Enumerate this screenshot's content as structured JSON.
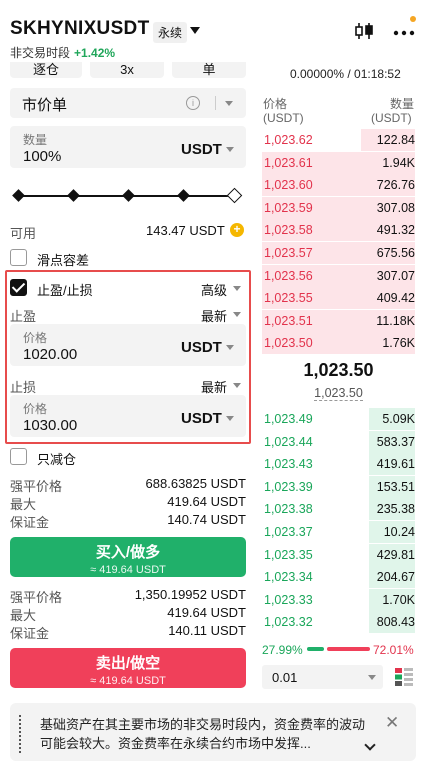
{
  "header": {
    "symbol": "SKHYNIXUSDT",
    "contract_type": "永续",
    "session": "非交易时段",
    "change_pct": "+1.42%"
  },
  "funding": {
    "text": "0.00000% / 01:18:52"
  },
  "margin_mode": {
    "isolated_label": "逐仓",
    "leverage_label": "3x",
    "mode_label": "单"
  },
  "order_form": {
    "order_type": "市价单",
    "qty_label": "数量",
    "qty_value": "100%",
    "qty_unit": "USDT",
    "slider_percent": 100,
    "available_label": "可用",
    "available_value": "143.47 USDT",
    "slippage_label": "滑点容差",
    "tpsl_label": "止盈/止损",
    "tpsl_mode": "高级",
    "take_profit": {
      "label": "止盈",
      "mode": "最新",
      "price_label": "价格",
      "price_value": "1020.00",
      "unit": "USDT"
    },
    "stop_loss": {
      "label": "止损",
      "mode": "最新",
      "price_label": "价格",
      "price_value": "1030.00",
      "unit": "USDT"
    },
    "reduce_only_label": "只减仓"
  },
  "buy_info": {
    "liq_label": "强平价格",
    "liq_value": "688.63825 USDT",
    "max_label": "最大",
    "max_value": "419.64 USDT",
    "margin_label": "保证金",
    "margin_value": "140.74 USDT",
    "button": "买入/做多",
    "button_sub": "≈ 419.64 USDT"
  },
  "sell_info": {
    "liq_label": "强平价格",
    "liq_value": "1,350.19952 USDT",
    "max_label": "最大",
    "max_value": "419.64 USDT",
    "margin_label": "保证金",
    "margin_value": "140.11 USDT",
    "button": "卖出/做空",
    "button_sub": "≈ 419.64 USDT"
  },
  "orderbook": {
    "price_header": "价格",
    "price_unit": "(USDT)",
    "qty_header": "数量",
    "qty_unit": "(USDT)",
    "asks": [
      {
        "price": "1,023.62",
        "qty": "122.84",
        "depth": 0.35
      },
      {
        "price": "1,023.61",
        "qty": "1.94K",
        "depth": 1.0
      },
      {
        "price": "1,023.60",
        "qty": "726.76",
        "depth": 1.0
      },
      {
        "price": "1,023.59",
        "qty": "307.08",
        "depth": 1.0
      },
      {
        "price": "1,023.58",
        "qty": "491.32",
        "depth": 1.0
      },
      {
        "price": "1,023.57",
        "qty": "675.56",
        "depth": 1.0
      },
      {
        "price": "1,023.56",
        "qty": "307.07",
        "depth": 1.0
      },
      {
        "price": "1,023.55",
        "qty": "409.42",
        "depth": 1.0
      },
      {
        "price": "1,023.51",
        "qty": "11.18K",
        "depth": 1.0
      },
      {
        "price": "1,023.50",
        "qty": "1.76K",
        "depth": 1.0
      }
    ],
    "mid_price": "1,023.50",
    "mark_price": "1,023.50",
    "bids": [
      {
        "price": "1,023.49",
        "qty": "5.09K",
        "depth": 0.3
      },
      {
        "price": "1,023.44",
        "qty": "583.37",
        "depth": 0.3
      },
      {
        "price": "1,023.43",
        "qty": "419.61",
        "depth": 0.3
      },
      {
        "price": "1,023.39",
        "qty": "153.51",
        "depth": 0.3
      },
      {
        "price": "1,023.38",
        "qty": "235.38",
        "depth": 0.3
      },
      {
        "price": "1,023.37",
        "qty": "10.24",
        "depth": 0.3
      },
      {
        "price": "1,023.35",
        "qty": "429.81",
        "depth": 0.3
      },
      {
        "price": "1,023.34",
        "qty": "204.67",
        "depth": 0.3
      },
      {
        "price": "1,023.33",
        "qty": "1.70K",
        "depth": 0.3
      },
      {
        "price": "1,023.32",
        "qty": "808.43",
        "depth": 0.3
      }
    ],
    "buy_ratio": "27.99%",
    "sell_ratio": "72.01%",
    "depth_step": "0.01"
  },
  "notice": {
    "text": "基础资产在其主要市场的非交易时段内，资金费率的波动可能会较大。资金费率在永续合约市场中发挥..."
  },
  "colors": {
    "buy": "#20b06a",
    "sell": "#f0405a",
    "highlight": "#e74c4c"
  }
}
